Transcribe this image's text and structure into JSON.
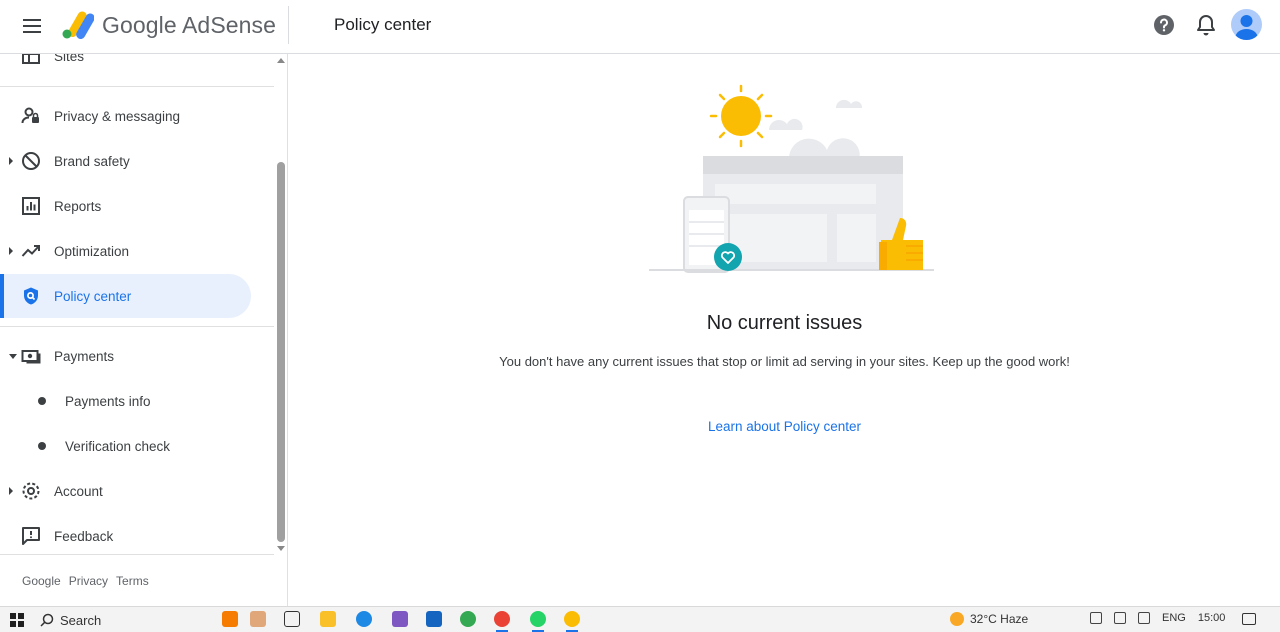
{
  "header": {
    "app_name": "Google AdSense",
    "page_title": "Policy center"
  },
  "sidebar": {
    "items": [
      {
        "label": "Sites",
        "icon": "sites-icon"
      },
      {
        "label": "Privacy & messaging",
        "icon": "privacy-icon"
      },
      {
        "label": "Brand safety",
        "icon": "block-icon"
      },
      {
        "label": "Reports",
        "icon": "reports-icon"
      },
      {
        "label": "Optimization",
        "icon": "trending-icon"
      },
      {
        "label": "Policy center",
        "icon": "shield-icon"
      },
      {
        "label": "Payments",
        "icon": "payments-icon"
      },
      {
        "label": "Account",
        "icon": "gear-icon"
      },
      {
        "label": "Feedback",
        "icon": "feedback-icon"
      }
    ],
    "payments_sub": [
      {
        "label": "Payments info"
      },
      {
        "label": "Verification check"
      }
    ],
    "footer": {
      "google": "Google",
      "privacy": "Privacy",
      "terms": "Terms"
    }
  },
  "main": {
    "heading": "No current issues",
    "description": "You don't have any current issues that stop or limit ad serving in your sites. Keep up the good work!",
    "link": "Learn about Policy center"
  },
  "taskbar": {
    "search_label": "Search",
    "weather": "32°C Haze",
    "lang": "ENG",
    "time": "15:00"
  },
  "colors": {
    "accent": "#1a73e8",
    "active_bg": "#e8f0fe",
    "sun": "#fbbc04",
    "teal": "#12a4af"
  }
}
